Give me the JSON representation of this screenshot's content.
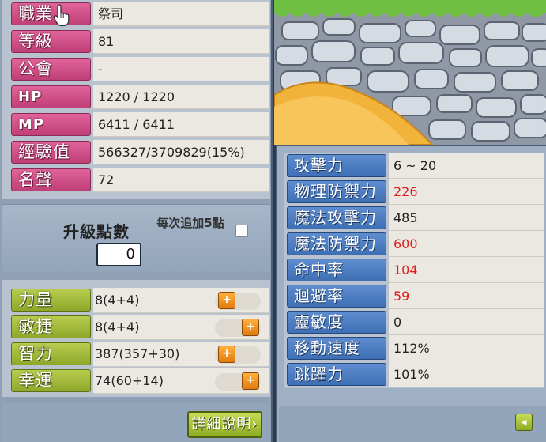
{
  "basic_info": [
    {
      "label": "職業",
      "value": "祭司"
    },
    {
      "label": "等級",
      "value": "81"
    },
    {
      "label": "公會",
      "value": "-"
    },
    {
      "label": "HP",
      "value": "1220 / 1220"
    },
    {
      "label": "MP",
      "value": "6411 / 6411"
    },
    {
      "label": "經驗值",
      "value": "566327/3709829(15%)"
    },
    {
      "label": "名聲",
      "value": "72"
    }
  ],
  "ability_points": {
    "label": "升級點數",
    "value": "0",
    "auto_add_label": "每次追加5點",
    "auto_add_checked": false
  },
  "stats": [
    {
      "label": "力量",
      "value": "8(4+4)",
      "add_button": "+"
    },
    {
      "label": "敏捷",
      "value": "8(4+4)",
      "add_button": "+"
    },
    {
      "label": "智力",
      "value": "387(357+30)",
      "add_button": "+"
    },
    {
      "label": "幸運",
      "value": "74(60+14)",
      "add_button": "+"
    }
  ],
  "detail_button_label": "詳細說明›",
  "detail_stats": [
    {
      "label": "攻擊力",
      "value": "6 ~ 20",
      "highlight": false
    },
    {
      "label": "物理防禦力",
      "value": "226",
      "highlight": true
    },
    {
      "label": "魔法攻擊力",
      "value": "485",
      "highlight": false
    },
    {
      "label": "魔法防禦力",
      "value": "600",
      "highlight": true
    },
    {
      "label": "命中率",
      "value": "104",
      "highlight": true
    },
    {
      "label": "迴避率",
      "value": "59",
      "highlight": true
    },
    {
      "label": "靈敏度",
      "value": "0",
      "highlight": false
    },
    {
      "label": "移動速度",
      "value": "112%",
      "highlight": false
    },
    {
      "label": "跳躍力",
      "value": "101%",
      "highlight": false
    }
  ],
  "collapse_button": "◂",
  "colors": {
    "basic_label": "#d4528a",
    "stat_label": "#a6bc3c",
    "detail_label": "#4f7fc4",
    "highlight_value": "#e21d1d"
  },
  "icons": {
    "cursor": "hand-pointer-icon",
    "add_point": "plus-icon",
    "collapse": "arrow-left-icon"
  }
}
